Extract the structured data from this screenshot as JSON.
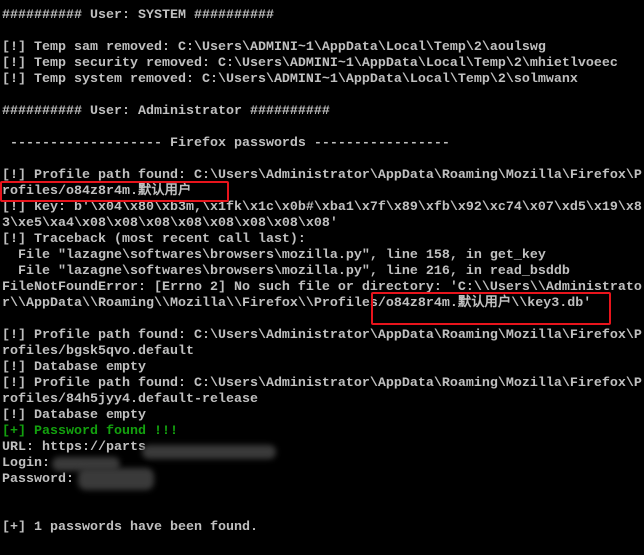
{
  "lines": [
    "########## User: SYSTEM ##########",
    "",
    "[!] Temp sam removed: C:\\Users\\ADMINI~1\\AppData\\Local\\Temp\\2\\aoulswg",
    "[!] Temp security removed: C:\\Users\\ADMINI~1\\AppData\\Local\\Temp\\2\\mhietlvoeec",
    "[!] Temp system removed: C:\\Users\\ADMINI~1\\AppData\\Local\\Temp\\2\\solmwanx",
    "",
    "########## User: Administrator ##########",
    "",
    " ------------------- Firefox passwords -----------------",
    "",
    "[!] Profile path found: C:\\Users\\Administrator\\AppData\\Roaming\\Mozilla\\Firefox\\P",
    "rofiles/o84z8r4m.默认用户",
    "[!] key: b'\\x04\\x80\\xb3m,\\x1fk\\x1c\\x0b#\\xba1\\x7f\\x89\\xfb\\x92\\xc74\\x07\\xd5\\x19\\x8",
    "3\\xe5\\xa4\\x08\\x08\\x08\\x08\\x08\\x08\\x08\\x08'",
    "[!] Traceback (most recent call last):",
    "  File \"lazagne\\softwares\\browsers\\mozilla.py\", line 158, in get_key",
    "  File \"lazagne\\softwares\\browsers\\mozilla.py\", line 216, in read_bsddb",
    "FileNotFoundError: [Errno 2] No such file or directory: 'C:\\\\Users\\\\Administrato",
    "r\\\\AppData\\\\Roaming\\\\Mozilla\\\\Firefox\\\\Profiles/o84z8r4m.默认用户\\\\key3.db'",
    "",
    "[!] Profile path found: C:\\Users\\Administrator\\AppData\\Roaming\\Mozilla\\Firefox\\P",
    "rofiles/bgsk5qvo.default",
    "[!] Database empty",
    "[!] Profile path found: C:\\Users\\Administrator\\AppData\\Roaming\\Mozilla\\Firefox\\P",
    "rofiles/84h5jyy4.default-release",
    "[!] Database empty",
    "[+] Password found !!!",
    "URL: https://parts",
    "Login:",
    "Password:",
    "",
    "",
    "[+] 1 passwords have been found."
  ],
  "highlight_color": "#e8141c",
  "success_color": "#13a10e"
}
